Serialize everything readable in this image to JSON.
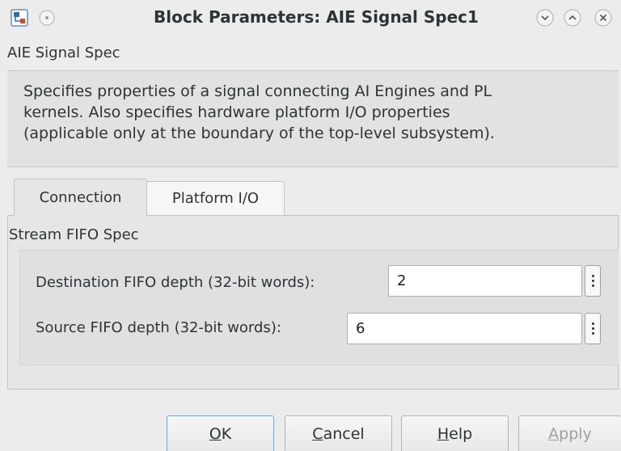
{
  "window": {
    "title": "Block Parameters: AIE Signal Spec1"
  },
  "block": {
    "name": "AIE Signal Spec",
    "description": "Specifies properties of a signal connecting AI Engines and PL\nkernels. Also specifies hardware platform I/O properties\n(applicable only at the boundary of the top-level subsystem)."
  },
  "tabs": [
    {
      "label": "Connection",
      "active": true
    },
    {
      "label": "Platform I/O",
      "active": false
    }
  ],
  "group": {
    "label": "Stream FIFO Spec",
    "fields": [
      {
        "label": "Destination FIFO depth (32-bit words):",
        "value": "2"
      },
      {
        "label": "Source FIFO depth (32-bit words):",
        "value": "6"
      }
    ]
  },
  "buttons": {
    "ok": {
      "mnemonic": "O",
      "rest": "K"
    },
    "cancel": {
      "mnemonic": "C",
      "rest": "ancel"
    },
    "help": {
      "mnemonic": "H",
      "rest": "elp"
    },
    "apply": {
      "mnemonic": "A",
      "rest": "pply",
      "enabled": false
    }
  },
  "icons": {
    "app": "simulink-block-icon",
    "minimize_left": "minimize-circle-icon",
    "minimize": "chevron-down-icon",
    "maximize": "chevron-up-icon",
    "close": "close-icon"
  },
  "colors": {
    "background": "#ececec",
    "ok_border": "#7fa4cc",
    "disabled_text": "#a0a0a0"
  }
}
